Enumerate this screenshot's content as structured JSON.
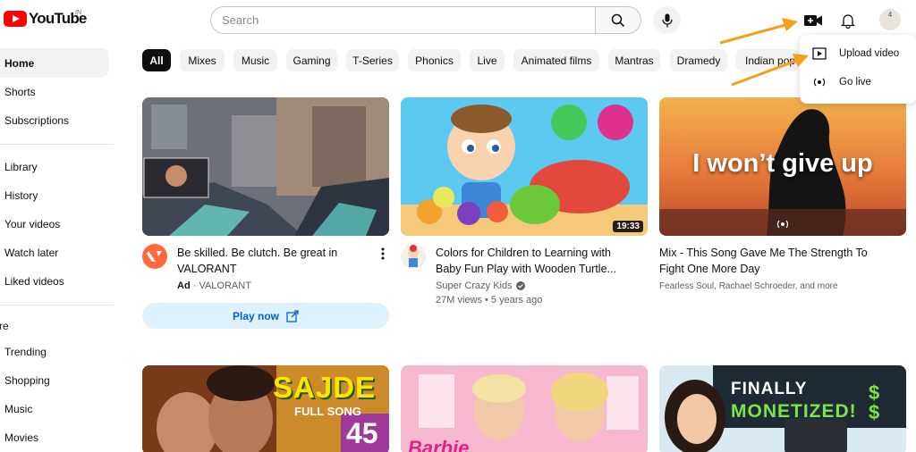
{
  "header": {
    "logo_text": "YouTube",
    "logo_region": "IN",
    "search_placeholder": "Search",
    "avatar_text": "4"
  },
  "sidebar": {
    "items_top": [
      "Home",
      "Shorts",
      "Subscriptions"
    ],
    "items_library": [
      "Library",
      "History",
      "Your videos",
      "Watch later",
      "Liked videos"
    ],
    "section_partial": "re",
    "items_explore": [
      "Trending",
      "Shopping",
      "Music",
      "Movies"
    ]
  },
  "chips": [
    "All",
    "Mixes",
    "Music",
    "Gaming",
    "T-Series",
    "Phonics",
    "Live",
    "Animated films",
    "Mantras",
    "Dramedy",
    "Indian pop"
  ],
  "videos": [
    {
      "title_line1": "Be skilled. Be clutch. Be great in",
      "title_line2": "VALORANT",
      "ad_badge": "Ad",
      "channel": "· VALORANT",
      "cta": "Play now"
    },
    {
      "title_line1": "Colors for Children to Learning with",
      "title_line2": "Baby Fun Play with Wooden Turtle...",
      "channel": "Super Crazy Kids",
      "stats": "27M views • 5 years ago",
      "duration": "19:33"
    },
    {
      "title_line1": "Mix - This Song Gave Me The Strength To",
      "title_line2": "Fight One More Day",
      "channel": "Fearless Soul, Rachael Schroeder, and more",
      "thumb_text": "I won’t give up"
    }
  ],
  "row2": {
    "sajde_title": "SAJDE",
    "sajde_sub": "FULL SONG",
    "sajde_num": "45",
    "barbie": "Barbie",
    "finally": "FINALLY",
    "monetized": "MONETIZED!",
    "dollars": "$ $"
  },
  "dropdown": {
    "items": [
      "Upload video",
      "Go live"
    ]
  },
  "colors": {
    "brand_red": "#ff0000",
    "arrow_orange": "#f5a01a",
    "play_now_bg": "#def1ff",
    "play_now_text": "#065fd4"
  }
}
